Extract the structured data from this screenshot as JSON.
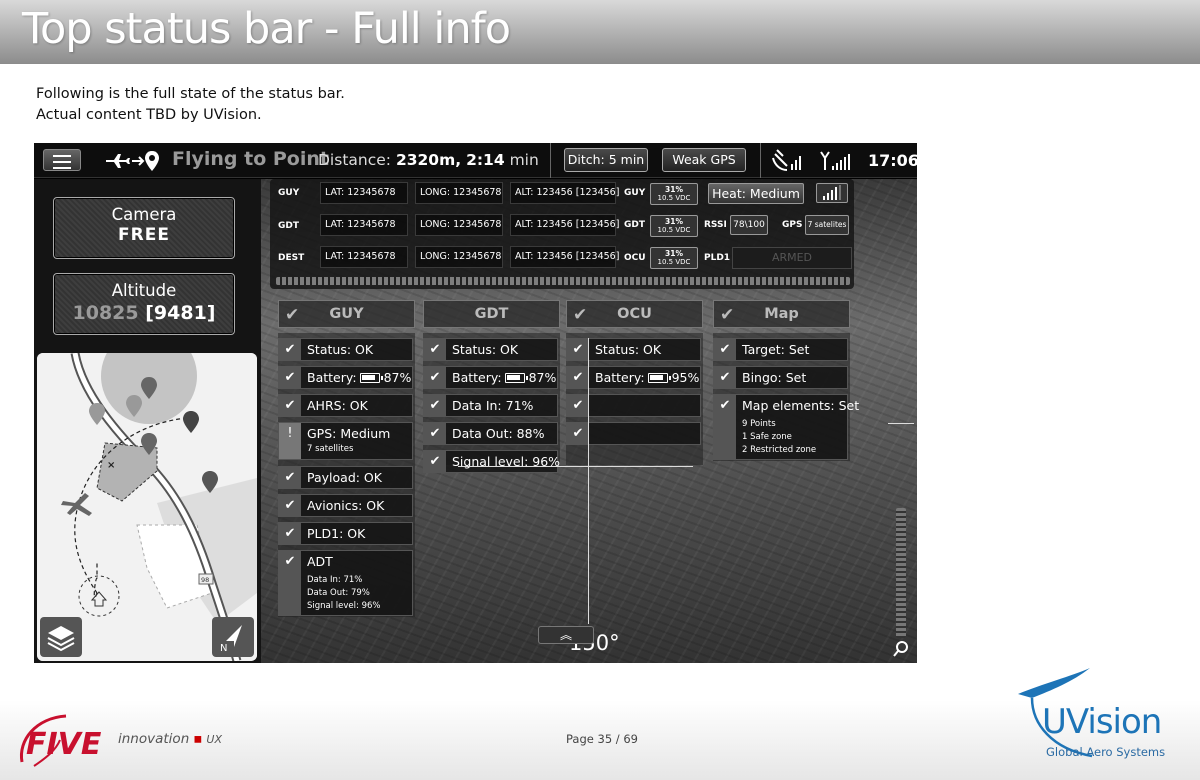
{
  "slide": {
    "title": "Top status bar - Full info",
    "intro_lines": [
      "Following is the full state of the status bar.",
      "Actual content TBD by UVision."
    ],
    "page_label": "Page 35 / 69"
  },
  "footer": {
    "brand_left": "FIVE",
    "tagline": "innovation",
    "tagline_dot": "▪",
    "tagline_ux": "UX",
    "brand_right": "UVision",
    "brand_right_sub": "Global Aero Systems"
  },
  "topbar": {
    "mission": "Flying to Point",
    "distance_label": "Distance:",
    "distance_value": "2320m,",
    "time_value": "2:14",
    "time_unit": "min",
    "ditch_label": "Ditch: 5 min",
    "gps_label": "Weak GPS",
    "clock": "17:06"
  },
  "left_panel": {
    "camera_title": "Camera",
    "camera_state": "FREE",
    "altitude_title": "Altitude",
    "altitude_value": "10825",
    "altitude_bracket": "[9481]",
    "map_road_sign": "98",
    "map_compass_letter": "N"
  },
  "info_panel": {
    "rows": [
      {
        "label": "GUY",
        "lat": "LAT: 12345678",
        "long": "LONG: 12345678",
        "alt": "ALT: 123456 [123456]",
        "unit": "GUY",
        "volt_pct": "31%",
        "volt_v": "10.5 VDC"
      },
      {
        "label": "GDT",
        "lat": "LAT: 12345678",
        "long": "LONG: 12345678",
        "alt": "ALT: 123456 [123456]",
        "unit": "GDT",
        "volt_pct": "31%",
        "volt_v": "10.5 VDC"
      },
      {
        "label": "DEST",
        "lat": "LAT: 12345678",
        "long": "LONG: 12345678",
        "alt": "ALT: 123456 [123456]",
        "unit": "OCU",
        "volt_pct": "31%",
        "volt_v": "10.5 VDC"
      }
    ],
    "heat_label": "Heat: Medium",
    "rssi_label": "RSSI",
    "rssi_value": "78\\100",
    "gps_label": "GPS",
    "gps_value": "7 satelites",
    "pld_label": "PLD1",
    "armed_label": "ARMED"
  },
  "columns": {
    "guy": {
      "title": "GUY",
      "items": [
        {
          "text": "Status: OK",
          "mark": "✔"
        },
        {
          "text": "Battery:",
          "batt": "87%",
          "mark": "✔"
        },
        {
          "text": "AHRS: OK",
          "mark": "✔"
        },
        {
          "text": "GPS: Medium",
          "sub": "7 satellites",
          "mark": "!"
        },
        {
          "text": "Payload: OK",
          "mark": "✔"
        },
        {
          "text": "Avionics: OK",
          "mark": "✔"
        },
        {
          "text": "PLD1: OK",
          "mark": "✔"
        },
        {
          "text": "ADT",
          "sub1": "Data In: 71%",
          "sub2": "Data Out: 79%",
          "sub3": "Signal level: 96%",
          "mark": "✔"
        }
      ]
    },
    "gdt": {
      "title": "GDT",
      "items": [
        {
          "text": "Status: OK",
          "mark": "✔"
        },
        {
          "text": "Battery:",
          "batt": "87%",
          "mark": "✔"
        },
        {
          "text": "Data In: 71%",
          "mark": "✔"
        },
        {
          "text": "Data Out: 88%",
          "mark": "✔"
        },
        {
          "text": "Signal level: 96%",
          "mark": "✔"
        }
      ]
    },
    "ocu": {
      "title": "OCU",
      "items": [
        {
          "text": "Status: OK",
          "mark": "✔"
        },
        {
          "text": "Battery:",
          "batt": "95%",
          "mark": "✔"
        }
      ]
    },
    "map": {
      "title": "Map",
      "items": [
        {
          "text": "Target: Set",
          "mark": "✔"
        },
        {
          "text": "Bingo: Set",
          "mark": "✔"
        },
        {
          "text": "Map elements: Set",
          "sub1": "9 Points",
          "sub2": "1 Safe zone",
          "sub3": "2 Restricted zone",
          "mark": "✔"
        }
      ]
    },
    "header_check": "✔"
  },
  "video": {
    "heading_value": "150°",
    "chevron": "︽"
  },
  "colors": {
    "accent_blue": "#1d74b7",
    "five_red": "#c8102e"
  }
}
